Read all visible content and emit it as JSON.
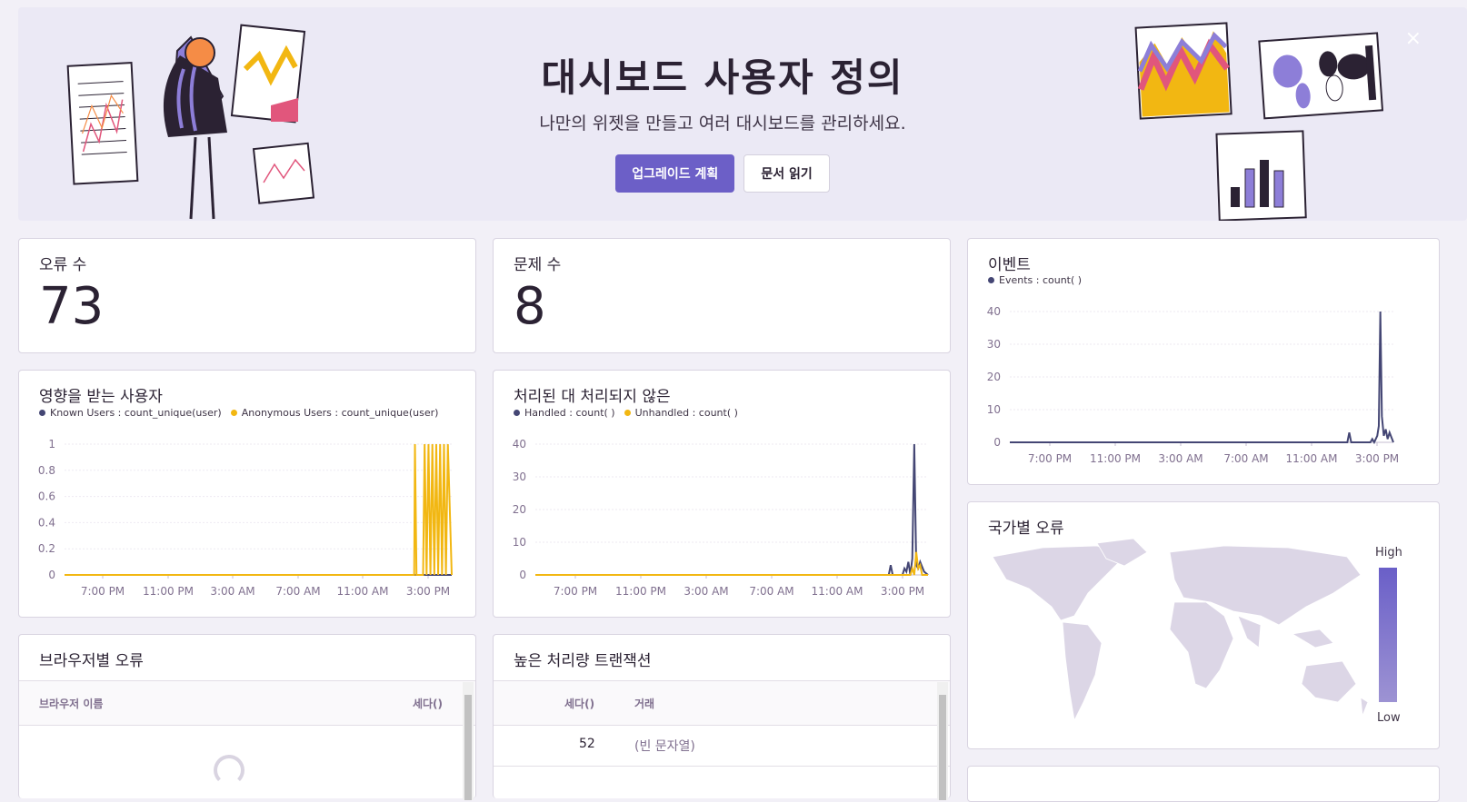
{
  "banner": {
    "title": "대시보드 사용자 정의",
    "subtitle": "나만의 위젯을 만들고 여러 대시보드를 관리하세요.",
    "upgrade_button": "업그레이드 계획",
    "docs_button": "문서 읽기",
    "close_icon": "×"
  },
  "colors": {
    "accent": "#6c5fc7",
    "series_dark": "#444674",
    "series_yellow": "#f2b712"
  },
  "widgets": {
    "error_count": {
      "title": "오류 수",
      "value": "73"
    },
    "issue_count": {
      "title": "문제 수",
      "value": "8"
    },
    "events": {
      "title": "이벤트",
      "legend": [
        "Events : count( )"
      ]
    },
    "affected_users": {
      "title": "영향을 받는 사용자",
      "legend": [
        "Known Users : count_unique(user)",
        "Anonymous Users : count_unique(user)"
      ]
    },
    "handled": {
      "title": "처리된 대 처리되지 않은",
      "legend": [
        "Handled : count( )",
        "Unhandled : count( )"
      ]
    },
    "errors_by_country": {
      "title": "국가별 오류",
      "legend_high": "High",
      "legend_low": "Low"
    },
    "errors_by_browser": {
      "title": "브라우저별 오류",
      "columns": [
        "브라우저 이름",
        "세다()"
      ]
    },
    "high_throughput": {
      "title": "높은 처리량 트랜잭션",
      "columns": [
        "세다()",
        "거래"
      ],
      "rows": [
        {
          "count": "52",
          "transaction": "(빈 문자열)"
        }
      ]
    }
  },
  "chart_data": [
    {
      "type": "line",
      "title": "이벤트",
      "x_ticks": [
        "7:00 PM",
        "11:00 PM",
        "3:00 AM",
        "7:00 AM",
        "11:00 AM",
        "3:00 PM"
      ],
      "y_ticks": [
        "0",
        "10",
        "20",
        "30",
        "40"
      ],
      "ylim": [
        0,
        40
      ],
      "series": [
        {
          "name": "Events : count( )",
          "points": [
            [
              0,
              0
            ],
            [
              0.88,
              0
            ],
            [
              0.885,
              3
            ],
            [
              0.89,
              0
            ],
            [
              0.94,
              0
            ],
            [
              0.945,
              1
            ],
            [
              0.95,
              0
            ],
            [
              0.958,
              2
            ],
            [
              0.962,
              5
            ],
            [
              0.966,
              40
            ],
            [
              0.97,
              8
            ],
            [
              0.975,
              2
            ],
            [
              0.98,
              4
            ],
            [
              0.985,
              1
            ],
            [
              0.99,
              3
            ],
            [
              1.0,
              0
            ]
          ]
        }
      ]
    },
    {
      "type": "line",
      "title": "영향을 받는 사용자",
      "x_ticks": [
        "7:00 PM",
        "11:00 PM",
        "3:00 AM",
        "7:00 AM",
        "11:00 AM",
        "3:00 PM"
      ],
      "y_ticks": [
        "0",
        "0.2",
        "0.4",
        "0.6",
        "0.8",
        "1"
      ],
      "ylim": [
        0,
        1
      ],
      "series": [
        {
          "name": "Known Users : count_unique(user)",
          "points": [
            [
              0,
              0
            ],
            [
              1.0,
              0
            ]
          ]
        },
        {
          "name": "Anonymous Users : count_unique(user)",
          "points": [
            [
              0,
              0
            ],
            [
              0.903,
              0
            ],
            [
              0.905,
              1
            ],
            [
              0.909,
              0
            ],
            [
              0.926,
              0
            ],
            [
              0.93,
              1
            ],
            [
              0.935,
              0
            ],
            [
              0.94,
              1
            ],
            [
              0.945,
              0
            ],
            [
              0.95,
              1
            ],
            [
              0.955,
              0
            ],
            [
              0.96,
              1
            ],
            [
              0.965,
              0
            ],
            [
              0.97,
              1
            ],
            [
              0.975,
              0
            ],
            [
              0.98,
              1
            ],
            [
              0.985,
              0
            ],
            [
              0.99,
              1
            ],
            [
              1.0,
              0
            ]
          ]
        }
      ]
    },
    {
      "type": "line",
      "title": "처리된 대 처리되지 않은",
      "x_ticks": [
        "7:00 PM",
        "11:00 PM",
        "3:00 AM",
        "7:00 AM",
        "11:00 AM",
        "3:00 PM"
      ],
      "y_ticks": [
        "0",
        "10",
        "20",
        "30",
        "40"
      ],
      "ylim": [
        0,
        40
      ],
      "series": [
        {
          "name": "Handled : count( )",
          "points": [
            [
              0,
              0
            ],
            [
              0.9,
              0
            ],
            [
              0.905,
              3
            ],
            [
              0.91,
              0
            ],
            [
              0.935,
              0
            ],
            [
              0.94,
              2
            ],
            [
              0.945,
              1
            ],
            [
              0.95,
              4
            ],
            [
              0.955,
              0
            ],
            [
              0.96,
              5
            ],
            [
              0.965,
              40
            ],
            [
              0.97,
              3
            ],
            [
              0.975,
              2
            ],
            [
              0.98,
              4
            ],
            [
              0.99,
              1
            ],
            [
              1.0,
              0
            ]
          ]
        },
        {
          "name": "Unhandled : count( )",
          "points": [
            [
              0,
              0
            ],
            [
              0.955,
              0
            ],
            [
              0.96,
              2
            ],
            [
              0.965,
              0
            ],
            [
              0.97,
              7
            ],
            [
              0.975,
              2
            ],
            [
              0.98,
              3
            ],
            [
              0.985,
              0
            ],
            [
              1.0,
              0
            ]
          ]
        }
      ]
    }
  ]
}
